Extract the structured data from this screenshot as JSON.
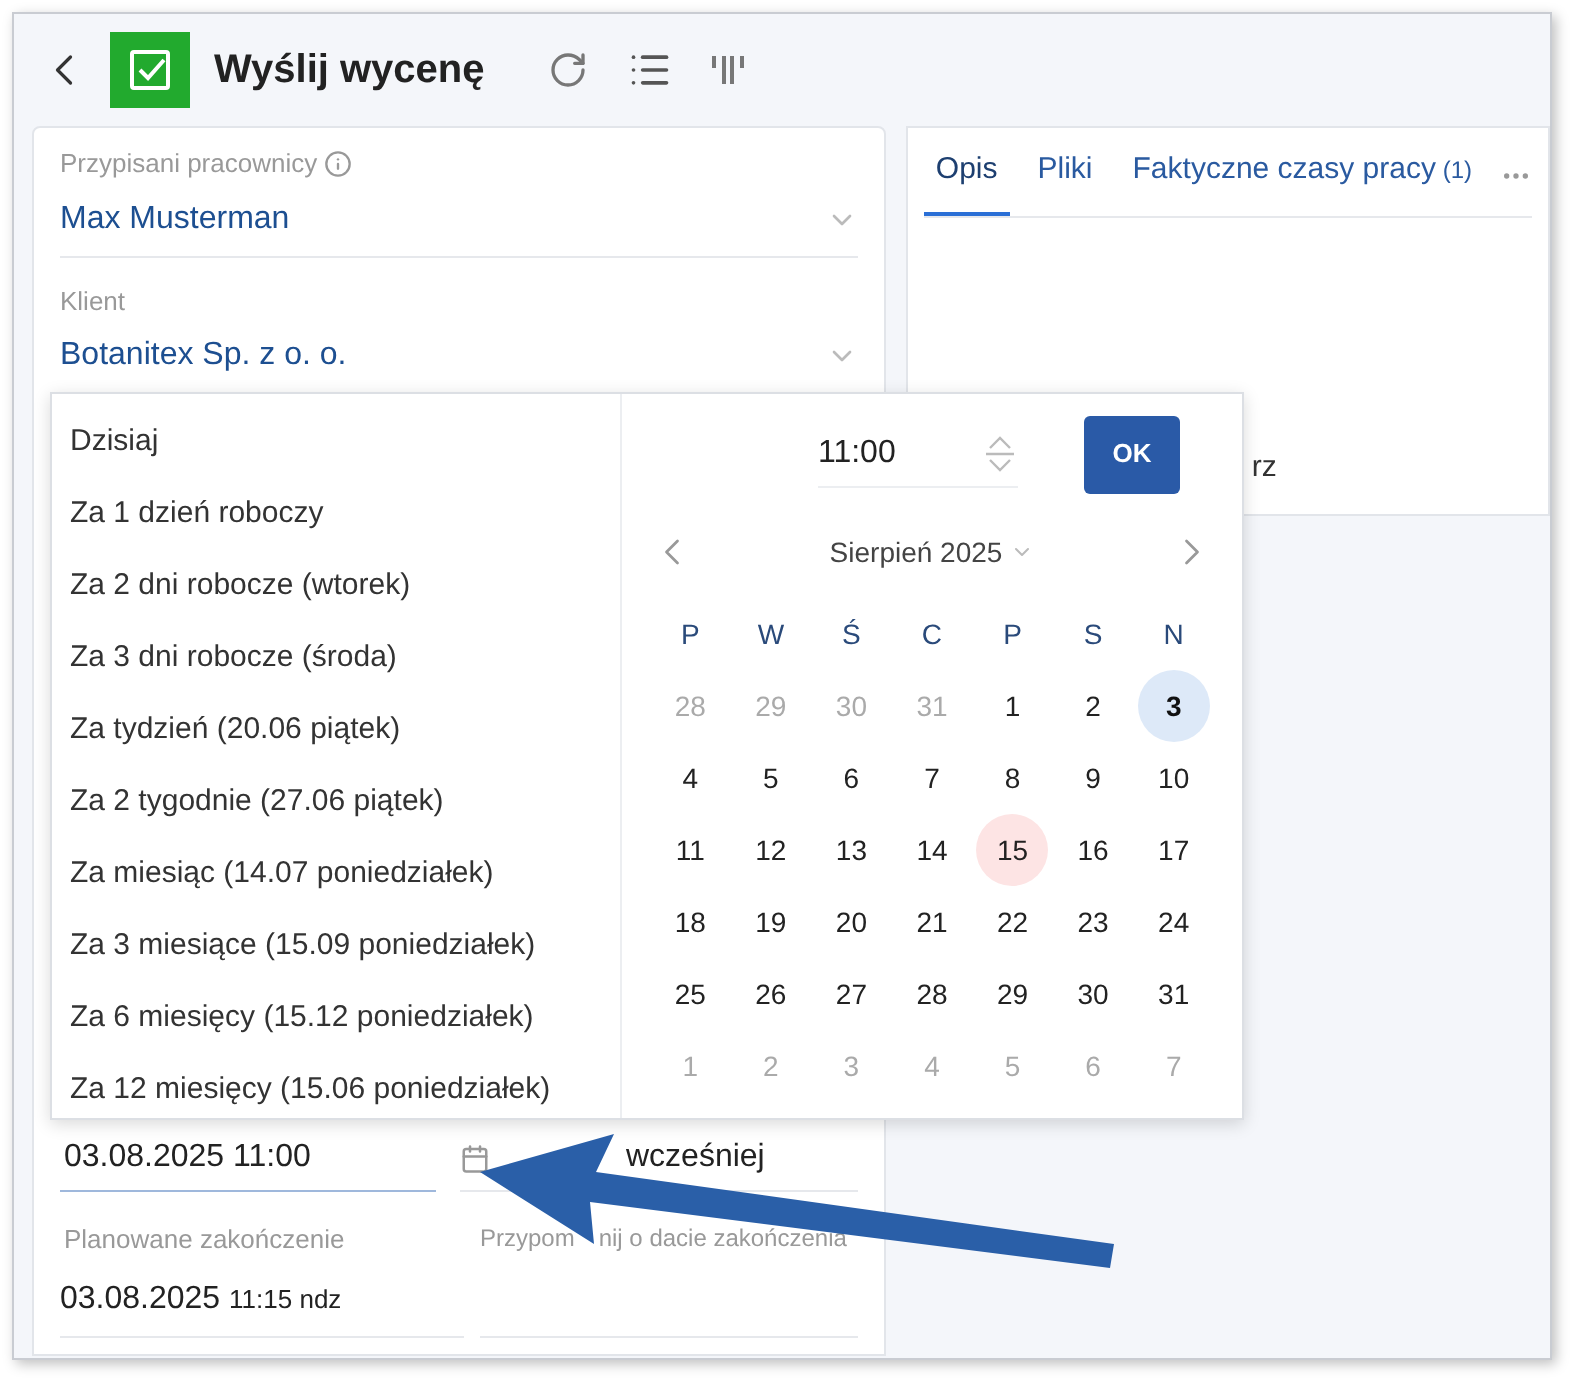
{
  "header": {
    "title": "Wyślij wycenę"
  },
  "fields": [
    {
      "label": "Przypisani pracownicy",
      "info": true,
      "value": "Max Musterman"
    },
    {
      "label": "Klient",
      "info": false,
      "value": "Botanitex Sp. z o. o."
    }
  ],
  "tabs": [
    {
      "label": "Opis",
      "selected": true
    },
    {
      "label": "Pliki",
      "selected": false
    },
    {
      "label": "Faktyczne czasy pracy",
      "count": "(1)",
      "selected": false
    }
  ],
  "right_panel_fragment": "rz",
  "quick_dates": [
    "Dzisiaj",
    "Za 1 dzień roboczy",
    "Za 2 dni robocze (wtorek)",
    "Za 3 dni robocze (środa)",
    "Za tydzień (20.06 piątek)",
    "Za 2 tygodnie (27.06 piątek)",
    "Za miesiąc (14.07 poniedziałek)",
    "Za 3 miesiące (15.09 poniedziałek)",
    "Za 6 miesięcy (15.12 poniedziałek)",
    "Za 12 miesięcy (15.06 poniedziałek)"
  ],
  "time": {
    "value": "11:00"
  },
  "ok_button": "OK",
  "calendar": {
    "month": "Sierpień 2025",
    "weekdays": [
      "P",
      "W",
      "Ś",
      "C",
      "P",
      "S",
      "N"
    ],
    "days": [
      {
        "d": "28",
        "outside": true,
        "selected": false,
        "holiday": false
      },
      {
        "d": "29",
        "outside": true,
        "selected": false,
        "holiday": false
      },
      {
        "d": "30",
        "outside": true,
        "selected": false,
        "holiday": false
      },
      {
        "d": "31",
        "outside": true,
        "selected": false,
        "holiday": false
      },
      {
        "d": "1",
        "outside": false,
        "selected": false,
        "holiday": false
      },
      {
        "d": "2",
        "outside": false,
        "selected": false,
        "holiday": false
      },
      {
        "d": "3",
        "outside": false,
        "selected": true,
        "holiday": false
      },
      {
        "d": "4",
        "outside": false,
        "selected": false,
        "holiday": false
      },
      {
        "d": "5",
        "outside": false,
        "selected": false,
        "holiday": false
      },
      {
        "d": "6",
        "outside": false,
        "selected": false,
        "holiday": false
      },
      {
        "d": "7",
        "outside": false,
        "selected": false,
        "holiday": false
      },
      {
        "d": "8",
        "outside": false,
        "selected": false,
        "holiday": false
      },
      {
        "d": "9",
        "outside": false,
        "selected": false,
        "holiday": false
      },
      {
        "d": "10",
        "outside": false,
        "selected": false,
        "holiday": false
      },
      {
        "d": "11",
        "outside": false,
        "selected": false,
        "holiday": false
      },
      {
        "d": "12",
        "outside": false,
        "selected": false,
        "holiday": false
      },
      {
        "d": "13",
        "outside": false,
        "selected": false,
        "holiday": false
      },
      {
        "d": "14",
        "outside": false,
        "selected": false,
        "holiday": false
      },
      {
        "d": "15",
        "outside": false,
        "selected": false,
        "holiday": true
      },
      {
        "d": "16",
        "outside": false,
        "selected": false,
        "holiday": false
      },
      {
        "d": "17",
        "outside": false,
        "selected": false,
        "holiday": false
      },
      {
        "d": "18",
        "outside": false,
        "selected": false,
        "holiday": false
      },
      {
        "d": "19",
        "outside": false,
        "selected": false,
        "holiday": false
      },
      {
        "d": "20",
        "outside": false,
        "selected": false,
        "holiday": false
      },
      {
        "d": "21",
        "outside": false,
        "selected": false,
        "holiday": false
      },
      {
        "d": "22",
        "outside": false,
        "selected": false,
        "holiday": false
      },
      {
        "d": "23",
        "outside": false,
        "selected": false,
        "holiday": false
      },
      {
        "d": "24",
        "outside": false,
        "selected": false,
        "holiday": false
      },
      {
        "d": "25",
        "outside": false,
        "selected": false,
        "holiday": false
      },
      {
        "d": "26",
        "outside": false,
        "selected": false,
        "holiday": false
      },
      {
        "d": "27",
        "outside": false,
        "selected": false,
        "holiday": false
      },
      {
        "d": "28",
        "outside": false,
        "selected": false,
        "holiday": false
      },
      {
        "d": "29",
        "outside": false,
        "selected": false,
        "holiday": false
      },
      {
        "d": "30",
        "outside": false,
        "selected": false,
        "holiday": false
      },
      {
        "d": "31",
        "outside": false,
        "selected": false,
        "holiday": false
      },
      {
        "d": "1",
        "outside": true,
        "selected": false,
        "holiday": false
      },
      {
        "d": "2",
        "outside": true,
        "selected": false,
        "holiday": false
      },
      {
        "d": "3",
        "outside": true,
        "selected": false,
        "holiday": false
      },
      {
        "d": "4",
        "outside": true,
        "selected": false,
        "holiday": false
      },
      {
        "d": "5",
        "outside": true,
        "selected": false,
        "holiday": false
      },
      {
        "d": "6",
        "outside": true,
        "selected": false,
        "holiday": false
      },
      {
        "d": "7",
        "outside": true,
        "selected": false,
        "holiday": false
      }
    ]
  },
  "start": {
    "value": "03.08.2025 11:00",
    "reminder_visible": "wcześniej"
  },
  "end": {
    "label": "Planowane zakończenie",
    "date": "03.08.2025",
    "time": "11:15 ndz",
    "reminder_label_parts": [
      "Przypom",
      "nij o dacie zakończenia"
    ]
  }
}
